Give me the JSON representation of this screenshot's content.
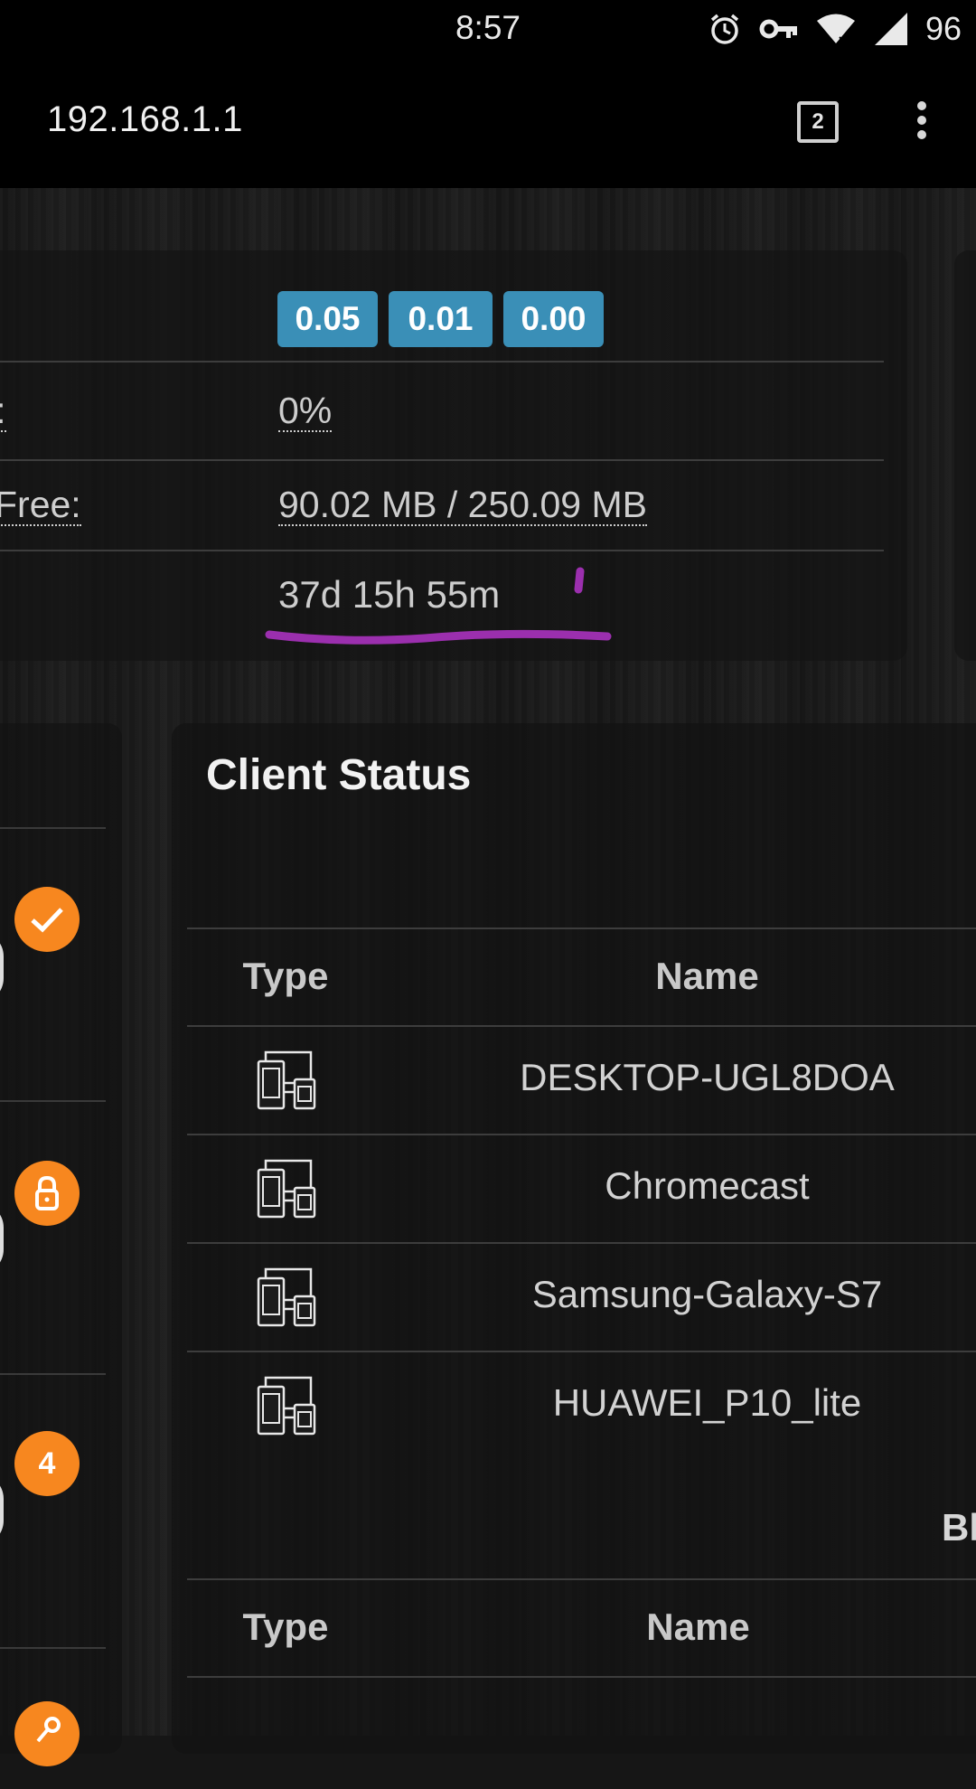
{
  "status_bar": {
    "time": "8:57",
    "battery": "96",
    "icons": [
      "alarm-icon",
      "vpn-key-icon",
      "wifi-icon",
      "signal-icon"
    ]
  },
  "browser": {
    "url": "192.168.1.1",
    "tab_count": "2",
    "menu_icon": "more-vert-icon"
  },
  "system_info": {
    "load_badges": [
      "0.05",
      "0.01",
      "0.00"
    ],
    "load_badge_color": "#3a8fb7",
    "rows": [
      {
        "label": ":",
        "value": ""
      },
      {
        "label": "l:",
        "value": "0%"
      },
      {
        "label": "Free:",
        "value": "90.02 MB / 250.09 MB"
      },
      {
        "label": "",
        "value": "37d 15h 55m"
      }
    ]
  },
  "side_card": {
    "badges": [
      {
        "icon": "check-icon",
        "text": ""
      },
      {
        "icon": "lock-icon",
        "text": ""
      },
      {
        "icon": "count-badge",
        "text": "4"
      },
      {
        "icon": "key-icon",
        "text": ""
      }
    ],
    "accent_color": "#f7871f"
  },
  "client_status": {
    "title": "Client Status",
    "columns": [
      "Type",
      "Name"
    ],
    "clients": [
      {
        "type_icon": "devices-icon",
        "name": "DESKTOP-UGL8DOA"
      },
      {
        "type_icon": "devices-icon",
        "name": "Chromecast"
      },
      {
        "type_icon": "devices-icon",
        "name": "Samsung-Galaxy-S7"
      },
      {
        "type_icon": "devices-icon",
        "name": "HUAWEI_P10_lite"
      }
    ],
    "second_table_heading": "Bl",
    "second_table_columns": [
      "Type",
      "Name"
    ]
  },
  "annotation_color": "#9b2fae"
}
